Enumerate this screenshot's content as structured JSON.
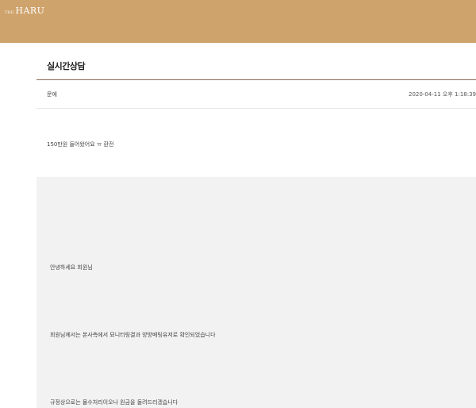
{
  "header": {
    "logo_small": "THE",
    "logo_text": "HARU"
  },
  "page": {
    "title": "실시간상담"
  },
  "post": {
    "author": "문에",
    "datetime": "2020-04-11 오후 1:18:39",
    "question": "150만원 들어왔어요 ㅠ 환전"
  },
  "answer": {
    "lines": [
      "안녕하세요 회원님",
      "회원님께서는 본사측에서 묘니터링결과 양방배팅유저로 확인되었습니다",
      "규정상으로는 몰수처리이오나 원금을 돌려드리겠습니다"
    ]
  },
  "colors": {
    "header_bg": "#cfa36c",
    "answer_bg": "#f2f2f2"
  }
}
